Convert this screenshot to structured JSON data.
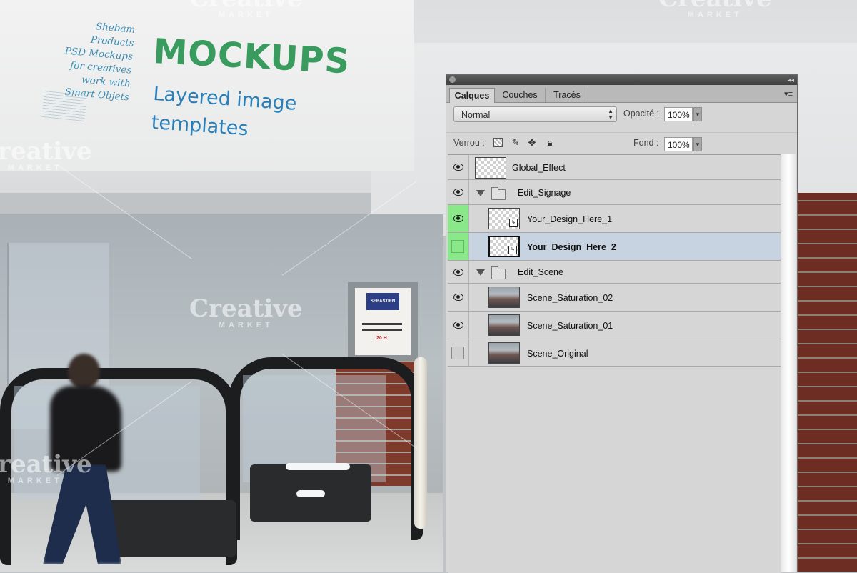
{
  "scene": {
    "sign": {
      "credits_lines": [
        "Shebam Products",
        "PSD Mockups",
        "for creatives",
        "work with",
        "Smart Objets"
      ],
      "title": "MOCKUPS",
      "subtitle_line1": "Layered image",
      "subtitle_line2": "templates",
      "title_color": "#3a9b5e",
      "subtitle_color": "#2b7fb8"
    },
    "poster": {
      "header": "SEBASTIEN",
      "line": "20 H"
    },
    "watermark": {
      "brand": "Creative",
      "sub": "MARKET"
    }
  },
  "panel": {
    "tabs": [
      {
        "label": "Calques",
        "active": true
      },
      {
        "label": "Couches",
        "active": false
      },
      {
        "label": "Tracés",
        "active": false
      }
    ],
    "blend_mode": "Normal",
    "opacity_label": "Opacité :",
    "opacity_value": "100%",
    "lock_label": "Verrou :",
    "fill_label": "Fond :",
    "fill_value": "100%",
    "layers": [
      {
        "name": "Global_Effect",
        "visible": true,
        "type": "layer",
        "thumb": "checker",
        "indent": 0,
        "selected": false,
        "highlight": false
      },
      {
        "name": "Edit_Signage",
        "visible": true,
        "type": "group",
        "indent": 0,
        "selected": false,
        "highlight": false
      },
      {
        "name": "Your_Design_Here_1",
        "visible": true,
        "type": "smart",
        "thumb": "checker",
        "indent": 1,
        "selected": false,
        "highlight": true
      },
      {
        "name": "Your_Design_Here_2",
        "visible": false,
        "type": "smart",
        "thumb": "checker",
        "indent": 1,
        "selected": true,
        "highlight": true
      },
      {
        "name": "Edit_Scene",
        "visible": true,
        "type": "group",
        "indent": 0,
        "selected": false,
        "highlight": false
      },
      {
        "name": "Scene_Saturation_02",
        "visible": true,
        "type": "layer",
        "thumb": "photo",
        "indent": 1,
        "selected": false,
        "highlight": false
      },
      {
        "name": "Scene_Saturation_01",
        "visible": true,
        "type": "layer",
        "thumb": "photo",
        "indent": 1,
        "selected": false,
        "highlight": false
      },
      {
        "name": "Scene_Original",
        "visible": false,
        "type": "layer",
        "thumb": "photo",
        "indent": 1,
        "selected": false,
        "highlight": false
      }
    ],
    "colors": {
      "selected_row": "#c7d3e1",
      "visibility_highlight": "#8ae88a"
    }
  }
}
